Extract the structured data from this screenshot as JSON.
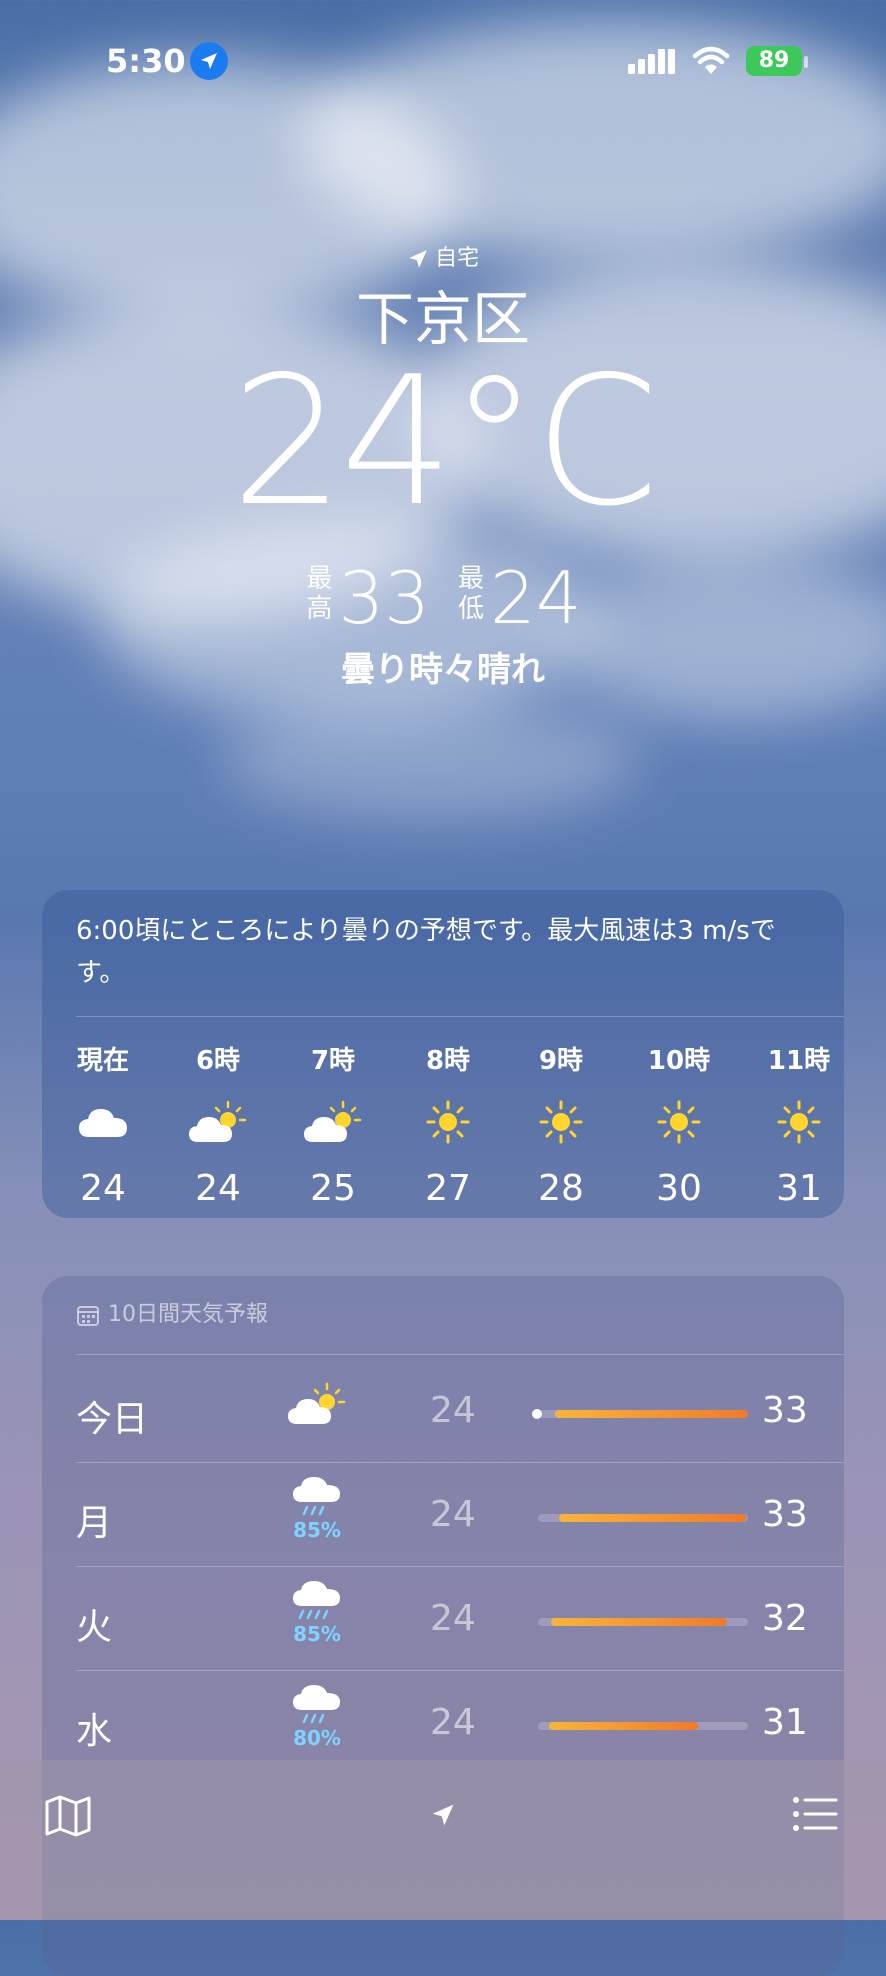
{
  "status_bar": {
    "time": "5:30",
    "battery": "89"
  },
  "header": {
    "home_label": "自宅",
    "city": "下京区",
    "temperature": "24°C",
    "high_label": "最高",
    "high": "33",
    "low_label": "最低",
    "low": "24",
    "condition": "曇り時々晴れ"
  },
  "hourly": {
    "summary": "6:00頃にところにより曇りの予想です。最大風速は3 m/sです。",
    "hours": [
      {
        "label": "現在",
        "icon": "cloud-icon",
        "temp": "24"
      },
      {
        "label": "6時",
        "icon": "partly-sunny-icon",
        "temp": "24"
      },
      {
        "label": "7時",
        "icon": "partly-sunny-icon",
        "temp": "25"
      },
      {
        "label": "8時",
        "icon": "sun-icon",
        "temp": "27"
      },
      {
        "label": "9時",
        "icon": "sun-icon",
        "temp": "28"
      },
      {
        "label": "10時",
        "icon": "sun-icon",
        "temp": "30"
      },
      {
        "label": "11時",
        "icon": "sun-icon",
        "temp": "31"
      }
    ]
  },
  "forecast": {
    "title": "10日間天気予報",
    "days": [
      {
        "day": "今日",
        "icon": "partly-sunny-icon",
        "precip": "",
        "low": "24",
        "high": "33",
        "range_start": 0.08,
        "range_end": 1.0
      },
      {
        "day": "月",
        "icon": "rain-cloud-icon",
        "precip": "85%",
        "low": "24",
        "high": "33",
        "range_start": 0.1,
        "range_end": 0.99
      },
      {
        "day": "火",
        "icon": "rain-cloud-icon",
        "precip": "85%",
        "low": "24",
        "high": "32",
        "range_start": 0.06,
        "range_end": 0.9
      },
      {
        "day": "水",
        "icon": "rain-cloud-icon",
        "precip": "80%",
        "low": "24",
        "high": "31",
        "range_start": 0.05,
        "range_end": 0.76
      }
    ]
  },
  "colors": {
    "accent_location": "#1a7cf0",
    "battery": "#3cc85a",
    "precip": "#7fd3ff",
    "bar_start": "#f8b53a",
    "bar_end": "#f07a2a"
  }
}
